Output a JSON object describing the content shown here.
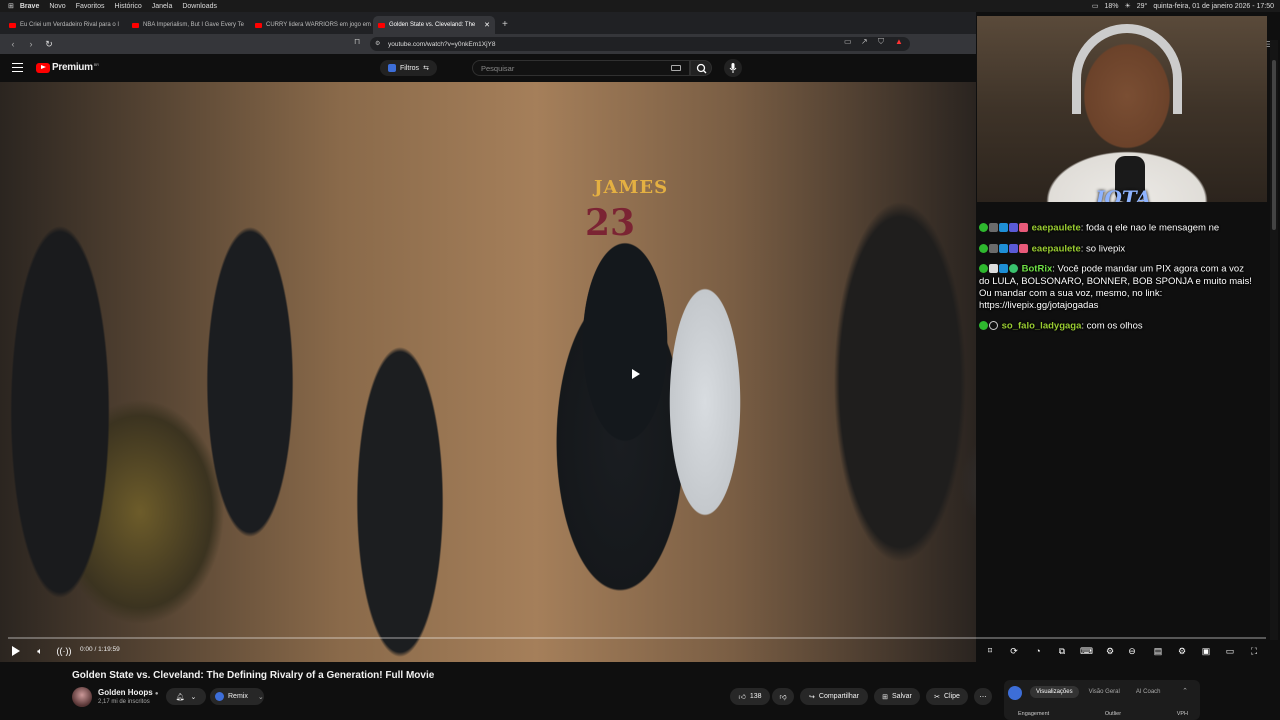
{
  "menubar": {
    "brand": "Brave",
    "items": [
      "Novo",
      "Favoritos",
      "Histórico",
      "Janela",
      "Downloads"
    ],
    "battery": "18%",
    "temp": "29°",
    "datetime": "quinta-feira, 01 de janeiro 2026 - 17:50"
  },
  "tabs": [
    {
      "label": "Eu Criei um Verdadeiro Rival para o I"
    },
    {
      "label": "NBA Imperialism, But I Gave Every Te"
    },
    {
      "label": "CURRY lidera WARRIORS em jogo em"
    },
    {
      "label": "Golden State vs. Cleveland: The"
    }
  ],
  "url": "youtube.com/watch?v=y0nkEm1XjY8",
  "youtube": {
    "logo": "Premium",
    "logo_sup": "BR",
    "filter_label": "Filtros",
    "search_placeholder": "Pesquisar"
  },
  "video": {
    "jersey_name": "JAMES",
    "jersey_number": "23",
    "time": "0:00 / 1:19:59",
    "progress": 0.0
  },
  "chat": [
    {
      "user": "eaepaulete",
      "text": "foda q ele nao le mensagem ne",
      "color": "#9acd32"
    },
    {
      "user": "eaepaulete",
      "text": "so livepix",
      "color": "#9acd32"
    },
    {
      "user": "BotRix",
      "text": "Você pode mandar um PIX agora com a voz do LULA, BOLSONARO, BONNER, BOB SPONJA e muito mais! Ou mandar com a sua voz, mesmo, no link: https://livepix.gg/jotajogadas",
      "color": "#6fe046"
    },
    {
      "user": "so_falo_ladygaga",
      "text": "com os olhos",
      "color": "#9acd32"
    }
  ],
  "cam": {
    "logo": "JOTA"
  },
  "info": {
    "title": "Golden State vs. Cleveland: The Defining Rivalry of a Generation! Full Movie",
    "channel": "Golden Hoops",
    "subs": "2,17 mi de inscritos",
    "remix": "Remix",
    "likes": "138",
    "share": "Compartilhar",
    "save": "Salvar",
    "clip": "Clipe"
  },
  "vph": {
    "tabs": [
      "Visualizações",
      "Visão Geral",
      "AI Coach"
    ],
    "columns": [
      "Engagement",
      "Outlier",
      "VPH"
    ]
  }
}
